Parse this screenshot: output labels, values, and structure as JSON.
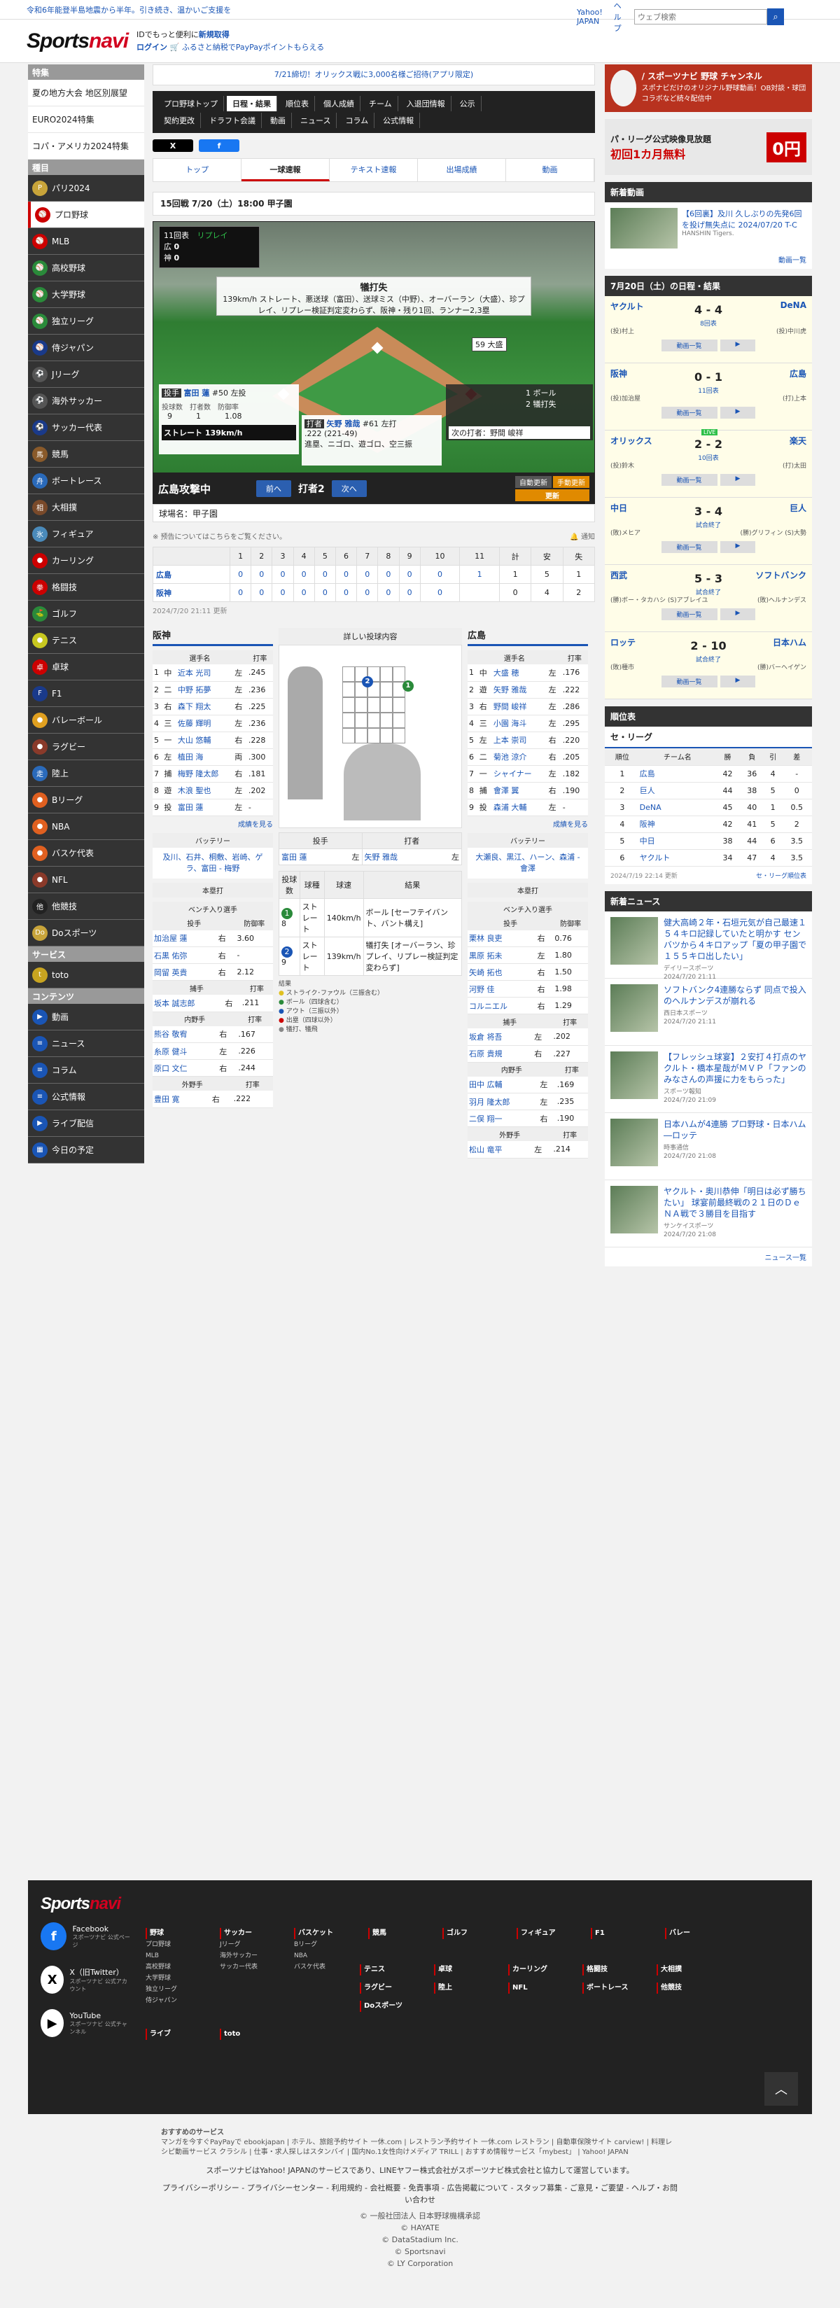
{
  "topbar": {
    "notice": "令和6年能登半島地震から半年。引き続き、温かいご支援を",
    "yahoo": "Yahoo! JAPAN",
    "help": "ヘルプ",
    "search_placeholder": "ウェブ検索"
  },
  "header": {
    "logo_a": "Sports",
    "logo_b": "navi",
    "promo1": "IDでもっと便利に",
    "promo1b": "新規取得",
    "promo2a": "ログイン",
    "promo2b": "ふるさと納税でPayPayポイントもらえる"
  },
  "sidebar": {
    "special_head": "特集",
    "special": [
      "夏の地方大会 地区別展望",
      "EURO2024特集",
      "コパ・アメリカ2024特集"
    ],
    "sports_head": "種目",
    "sports": [
      {
        "label": "パリ2024",
        "color": "#c8a43a",
        "glyph": "P"
      },
      {
        "label": "プロ野球",
        "color": "#c00",
        "glyph": "⚾",
        "active": true
      },
      {
        "label": "MLB",
        "color": "#c00",
        "glyph": "⚾"
      },
      {
        "label": "高校野球",
        "color": "#2a8a3a",
        "glyph": "⚾"
      },
      {
        "label": "大学野球",
        "color": "#2a8a3a",
        "glyph": "⚾"
      },
      {
        "label": "独立リーグ",
        "color": "#2a8a3a",
        "glyph": "⚾"
      },
      {
        "label": "侍ジャパン",
        "color": "#1a3a8a",
        "glyph": "⚾"
      },
      {
        "label": "Jリーグ",
        "color": "#555",
        "glyph": "⚽"
      },
      {
        "label": "海外サッカー",
        "color": "#555",
        "glyph": "⚽"
      },
      {
        "label": "サッカー代表",
        "color": "#1a3a8a",
        "glyph": "⚽"
      },
      {
        "label": "競馬",
        "color": "#8a5a2a",
        "glyph": "馬"
      },
      {
        "label": "ボートレース",
        "color": "#2a6aba",
        "glyph": "舟"
      },
      {
        "label": "大相撲",
        "color": "#7a4a2a",
        "glyph": "相"
      },
      {
        "label": "フィギュア",
        "color": "#4a8aba",
        "glyph": "氷"
      },
      {
        "label": "カーリング",
        "color": "#c00",
        "glyph": "●"
      },
      {
        "label": "格闘技",
        "color": "#c00",
        "glyph": "拳"
      },
      {
        "label": "ゴルフ",
        "color": "#2a8a3a",
        "glyph": "⛳"
      },
      {
        "label": "テニス",
        "color": "#c8c820",
        "glyph": "●"
      },
      {
        "label": "卓球",
        "color": "#c00",
        "glyph": "卓"
      },
      {
        "label": "F1",
        "color": "#1a3a8a",
        "glyph": "F"
      },
      {
        "label": "バレーボール",
        "color": "#e0a020",
        "glyph": "●"
      },
      {
        "label": "ラグビー",
        "color": "#8a3a2a",
        "glyph": "●"
      },
      {
        "label": "陸上",
        "color": "#2a6aba",
        "glyph": "走"
      },
      {
        "label": "Bリーグ",
        "color": "#e06020",
        "glyph": "●"
      },
      {
        "label": "NBA",
        "color": "#e06020",
        "glyph": "●"
      },
      {
        "label": "バスケ代表",
        "color": "#e06020",
        "glyph": "●"
      },
      {
        "label": "NFL",
        "color": "#8a3a2a",
        "glyph": "●"
      },
      {
        "label": "他競技",
        "color": "#222",
        "glyph": "他"
      },
      {
        "label": "Doスポーツ",
        "color": "#c8a43a",
        "glyph": "Do"
      }
    ],
    "service_head": "サービス",
    "service": [
      {
        "label": "toto",
        "color": "#c8a420",
        "glyph": "t"
      }
    ],
    "content_head": "コンテンツ",
    "content": [
      {
        "label": "動画",
        "glyph": "▶"
      },
      {
        "label": "ニュース",
        "glyph": "≡"
      },
      {
        "label": "コラム",
        "glyph": "≡"
      },
      {
        "label": "公式情報",
        "glyph": "≡"
      },
      {
        "label": "ライブ配信",
        "glyph": "▶"
      },
      {
        "label": "今日の予定",
        "glyph": "▦"
      }
    ]
  },
  "main": {
    "banner": "7/21締切！オリックス戦に3,000名様ご招待(アプリ限定)",
    "nav_row1": [
      "プロ野球トップ",
      "日程・結果",
      "順位表",
      "個人成績",
      "チーム",
      "入退団情報",
      "公示"
    ],
    "nav_row2": [
      "契約更改",
      "ドラフト会議",
      "動画",
      "ニュース",
      "コラム",
      "公式情報"
    ],
    "share_x": "X",
    "share_fb": "f",
    "tabs": [
      "トップ",
      "一球速報",
      "テキスト速報",
      "出場成績",
      "動画"
    ],
    "game_head": "15回戦 7/20（土）18:00 甲子園",
    "scoreboard": {
      "inning": "11回表",
      "status": "リプレイ",
      "hiro": "広",
      "hiro_s": "0",
      "han": "神",
      "han_s": "0"
    },
    "play": {
      "title": "犠打失",
      "desc": "139km/h ストレート、悪送球（富田）、送球ミス（中野）、オーバーラン（大盛）、珍プレイ、リプレー検証判定変わらず、阪神・残り1回、ランナー2,3塁"
    },
    "runner_label": "59 大盛",
    "pitcher": {
      "role": "投手",
      "name": "富田 蓮",
      "num": "#50",
      "hand": "左投",
      "h1": "投球数",
      "h2": "打者数",
      "h3": "防御率",
      "v1": "9",
      "v2": "1",
      "v3": "1.08",
      "pitch": "ストレート 139km/h"
    },
    "batter": {
      "role": "打者",
      "name": "矢野 雅哉",
      "num": "#61",
      "hand": "左打",
      "avg": ".222 (221-49)",
      "note": "進塁、ニゴロ、遊ゴロ、空三振"
    },
    "count": {
      "ball": "1 ボール",
      "strike": "2 犠打失",
      "next": "次の打者：野間 峻祥"
    },
    "pbar": {
      "attack": "広島攻撃中",
      "prev": "前へ",
      "batter_no": "打者2",
      "next": "次へ",
      "auto": "自動更新",
      "manual": "手動更新",
      "refresh": "更新"
    },
    "venue": "球場名：甲子園",
    "note": "※ 预告についてはこちらをご覧ください。",
    "notify": "通知",
    "linescore": {
      "headers": [
        "",
        "1",
        "2",
        "3",
        "4",
        "5",
        "6",
        "7",
        "8",
        "9",
        "10",
        "11",
        "計",
        "安",
        "失"
      ],
      "rows": [
        {
          "team": "広島",
          "cells": [
            "0",
            "0",
            "0",
            "0",
            "0",
            "0",
            "0",
            "0",
            "0",
            "0",
            "1",
            "1",
            "5",
            "1"
          ]
        },
        {
          "team": "阪神",
          "cells": [
            "0",
            "0",
            "0",
            "0",
            "0",
            "0",
            "0",
            "0",
            "0",
            "0",
            "",
            "0",
            "4",
            "2"
          ]
        }
      ]
    },
    "updated": "2024/7/20 21:11 更新",
    "hanshin": {
      "title": "阪神",
      "col_name": "選手名",
      "col_avg": "打率",
      "lineup": [
        [
          "1",
          "中",
          "近本 光司",
          "左",
          ".245"
        ],
        [
          "2",
          "二",
          "中野 拓夢",
          "左",
          ".236"
        ],
        [
          "3",
          "右",
          "森下 翔太",
          "右",
          ".225"
        ],
        [
          "4",
          "三",
          "佐藤 輝明",
          "左",
          ".236"
        ],
        [
          "5",
          "一",
          "大山 悠輔",
          "右",
          ".228"
        ],
        [
          "6",
          "左",
          "植田 海",
          "両",
          ".300"
        ],
        [
          "7",
          "捕",
          "梅野 隆太郎",
          "右",
          ".181"
        ],
        [
          "8",
          "遊",
          "木浪 聖也",
          "左",
          ".202"
        ],
        [
          "9",
          "投",
          "富田 蓮",
          "左",
          "-"
        ]
      ],
      "more": "成績を見る",
      "battery_head": "バッテリー",
      "battery": "及川、石井、桐敷、岩崎、ゲラ、富田 - 梅野",
      "hr_head": "本塁打",
      "bench_head": "ベンチ入り選手",
      "bp_head": "投手",
      "bp_col": "防御率",
      "bp": [
        [
          "加治屋 蓮",
          "右",
          "3.60"
        ],
        [
          "石黒 佑弥",
          "右",
          "-"
        ],
        [
          "岡留 英貴",
          "右",
          "2.12"
        ]
      ],
      "bc_head": "捕手",
      "bc": [
        [
          "坂本 誠志郎",
          "右",
          ".211"
        ]
      ],
      "bi_head": "内野手",
      "bi": [
        [
          "熊谷 敬宥",
          "右",
          ".167"
        ],
        [
          "糸原 健斗",
          "左",
          ".226"
        ],
        [
          "原口 文仁",
          "右",
          ".244"
        ]
      ],
      "bo_head": "外野手",
      "bo": [
        [
          "豊田 寛",
          "右",
          ".222"
        ]
      ]
    },
    "carp": {
      "title": "広島",
      "col_name": "選手名",
      "col_avg": "打率",
      "lineup": [
        [
          "1",
          "中",
          "大盛 穂",
          "左",
          ".176"
        ],
        [
          "2",
          "遊",
          "矢野 雅哉",
          "左",
          ".222"
        ],
        [
          "3",
          "右",
          "野間 峻祥",
          "左",
          ".286"
        ],
        [
          "4",
          "三",
          "小園 海斗",
          "左",
          ".295"
        ],
        [
          "5",
          "左",
          "上本 崇司",
          "右",
          ".220"
        ],
        [
          "6",
          "二",
          "菊池 涼介",
          "右",
          ".205"
        ],
        [
          "7",
          "一",
          "シャイナー",
          "左",
          ".182"
        ],
        [
          "8",
          "捕",
          "會澤 翼",
          "右",
          ".190"
        ],
        [
          "9",
          "投",
          "森浦 大輔",
          "左",
          "-"
        ]
      ],
      "more": "成績を見る",
      "battery_head": "バッテリー",
      "battery": "大瀬良、黒江、ハーン、森浦 - 會澤",
      "hr_head": "本塁打",
      "bench_head": "ベンチ入り選手",
      "bp_head": "投手",
      "bp_col": "防御率",
      "bp": [
        [
          "栗林 良吏",
          "右",
          "0.76"
        ],
        [
          "黒原 拓未",
          "左",
          "1.80"
        ],
        [
          "矢崎 拓也",
          "右",
          "1.50"
        ],
        [
          "河野 佳",
          "右",
          "1.98"
        ],
        [
          "コルニエル",
          "右",
          "1.29"
        ]
      ],
      "bc_head": "捕手",
      "bc": [
        [
          "坂倉 将吾",
          "左",
          ".202"
        ],
        [
          "石原 貴規",
          "右",
          ".227"
        ]
      ],
      "bi_head": "内野手",
      "bi": [
        [
          "田中 広輔",
          "左",
          ".169"
        ],
        [
          "羽月 隆太郎",
          "左",
          ".235"
        ],
        [
          "二俣 翔一",
          "右",
          ".190"
        ]
      ],
      "bo_head": "外野手",
      "bo": [
        [
          "松山 竜平",
          "左",
          ".214"
        ]
      ]
    },
    "zone": {
      "title": "詳しい投球内容",
      "p_head": "投手",
      "b_head": "打者",
      "pitcher": "富田 蓮",
      "pitcher_hand": "左",
      "batter": "矢野 雅哉",
      "batter_hand": "左",
      "cols": [
        "投球数",
        "球種",
        "球速",
        "結果"
      ],
      "rows": [
        {
          "no": "1",
          "n": "8",
          "type": "ストレート",
          "speed": "140km/h",
          "result": "ボール [セーフテイバント、バント構え]",
          "color": "#2a8a3a"
        },
        {
          "no": "2",
          "n": "9",
          "type": "ストレート",
          "speed": "139km/h",
          "result": "犠打失 [オーバーラン、珍プレイ、リプレー検証判定変わらず]",
          "color": "#1a55b5"
        }
      ],
      "legend_head": "結果",
      "legend": [
        "ストライク･ファウル（三振含む）",
        "ボール（四球含む）",
        "アウト（三振以外）",
        "出塁（四球以外）",
        "犠打、犠飛"
      ],
      "legend_colors": [
        "#e0c020",
        "#2a8a3a",
        "#1a55b5",
        "#c00",
        "#888"
      ]
    }
  },
  "right": {
    "ch_title": "/ スポーツナビ 野球 チャンネル",
    "ch_sub": "スポナビだけのオリジナル野球動画！OB対談・球団コラボなど続々配信中",
    "pl_title": "パ・リーグ公式映像見放題",
    "pl_sub": "初回1カ月無料",
    "pl_price": "0円",
    "video_head": "新着動画",
    "video": {
      "title": "【6回裏】及川 久しぶりの先発6回を投げ無失点に 2024/07/20 T-C",
      "meta": "HANSHIN Tigers.",
      "more": "動画一覧"
    },
    "sched_head": "7月20日（土）の日程・結果",
    "games": [
      {
        "home": "ヤクルト",
        "away": "DeNA",
        "score": "4 - 4",
        "status": "8回表",
        "hp": "(投)村上",
        "ap": "(投)中川虎",
        "btn1": "動画一覧"
      },
      {
        "home": "阪神",
        "away": "広島",
        "score": "0 - 1",
        "status": "11回表",
        "hp": "(投)加治屋",
        "ap": "(打)上本",
        "btn1": "動画一覧"
      },
      {
        "home": "オリックス",
        "away": "楽天",
        "score": "2 - 2",
        "status": "10回表",
        "hp": "(投)鈴木",
        "ap": "(打)太田",
        "btn1": "動画一覧",
        "live": "LIVE"
      },
      {
        "home": "中日",
        "away": "巨人",
        "score": "3 - 4",
        "status": "試合終了",
        "hp": "(敗)メヒア",
        "ap": "(勝)グリフィン (S)大勢",
        "btn1": "動画一覧"
      },
      {
        "home": "西武",
        "away": "ソフトバンク",
        "score": "5 - 3",
        "status": "試合終了",
        "hp": "(勝)ボー・タカハシ (S)アブレイユ",
        "ap": "(敗)ヘルナンデス",
        "btn1": "動画一覧"
      },
      {
        "home": "ロッテ",
        "away": "日本ハム",
        "score": "2 - 10",
        "status": "試合終了",
        "hp": "(敗)種市",
        "ap": "(勝)バーヘイゲン",
        "btn1": "動画一覧"
      }
    ],
    "stand_head": "順位表",
    "stand_league": "セ・リーグ",
    "stand_cols": [
      "順位",
      "チーム名",
      "勝",
      "負",
      "引",
      "差"
    ],
    "stand": [
      [
        "1",
        "広島",
        "42",
        "36",
        "4",
        "-"
      ],
      [
        "2",
        "巨人",
        "44",
        "38",
        "5",
        "0"
      ],
      [
        "3",
        "DeNA",
        "45",
        "40",
        "1",
        "0.5"
      ],
      [
        "4",
        "阪神",
        "42",
        "41",
        "5",
        "2"
      ],
      [
        "5",
        "中日",
        "38",
        "44",
        "6",
        "3.5"
      ],
      [
        "6",
        "ヤクルト",
        "34",
        "47",
        "4",
        "3.5"
      ]
    ],
    "stand_time": "2024/7/19 22:14 更新",
    "stand_more": "セ・リーグ順位表",
    "news_head": "新着ニュース",
    "news": [
      {
        "title": "健大高崎２年・石垣元気が自己最速１５４キロ記録していたと明かす センバツから４キロアップ「夏の甲子園で１５５キロ出したい」",
        "src": "デイリースポーツ",
        "time": "2024/7/20 21:11"
      },
      {
        "title": "ソフトバンク4連勝ならず 同点で投入のヘルナンデスが崩れる",
        "src": "西日本スポーツ",
        "time": "2024/7/20 21:11"
      },
      {
        "title": "【フレッシュ球宴】２安打４打点のヤクルト・橋本星哉がＭＶＰ「ファンのみなさんの声援に力をもらった」",
        "src": "スポーツ報知",
        "time": "2024/7/20 21:09"
      },
      {
        "title": "日本ハムが4連勝 プロ野球・日本ハム―ロッテ",
        "src": "時事通信",
        "time": "2024/7/20 21:08"
      },
      {
        "title": "ヤクルト・奥川恭伸「明日は必ず勝ちたい」 球宴前最終戦の２１日のＤｅＮＡ戦で３勝目を目指す",
        "src": "サンケイスポーツ",
        "time": "2024/7/20 21:08"
      }
    ],
    "news_more": "ニュース一覧"
  },
  "footer": {
    "social": [
      {
        "name": "Facebook",
        "sub": "スポーツナビ 公式ページ",
        "glyph": "f",
        "color": "#1877f2"
      },
      {
        "name": "X（旧Twitter）",
        "sub": "スポーツナビ 公式アカウント",
        "glyph": "X",
        "color": "#fff"
      },
      {
        "name": "YouTube",
        "sub": "スポーツナビ 公式チャンネル",
        "glyph": "▶",
        "color": "#fff"
      }
    ],
    "cols": [
      {
        "head": "野球",
        "items": [
          "プロ野球",
          "MLB",
          "高校野球",
          "大学野球",
          "独立リーグ",
          "侍ジャパン"
        ]
      },
      {
        "head": "サッカー",
        "items": [
          "Jリーグ",
          "海外サッカー",
          "サッカー代表"
        ]
      },
      {
        "head": "バスケット",
        "items": [
          "Bリーグ",
          "NBA",
          "バスケ代表"
        ]
      },
      {
        "head": "競馬",
        "items": []
      },
      {
        "head": "ゴルフ",
        "items": []
      },
      {
        "head": "フィギュア",
        "items": []
      },
      {
        "head": "F1",
        "items": []
      },
      {
        "head": "バレー",
        "items": []
      }
    ],
    "row2": [
      "テニス",
      "卓球",
      "カーリング",
      "格闘技",
      "大相撲"
    ],
    "row3": [
      "ラグビー",
      "陸上",
      "NFL",
      "ボートレース",
      "他競技"
    ],
    "row4": [
      "Doスポーツ"
    ],
    "row5": [
      "ライブ",
      "toto"
    ]
  },
  "bottom": {
    "links_head": "おすすめのサービス",
    "links": "マンガを今すぐPayPayで ebookjapan | ホテル、旅館予約サイト 一休.com | レストラン予約サイト 一休.com レストラン | 自動車保険サイト carview! | 料理レシピ動画サービス クラシル | 仕事・求人探しはスタンバイ | 国内No.1女性向けメディア TRILL | おすすめ情報サービス「mybest」 | Yahoo! JAPAN",
    "disclaimer": "スポーツナビはYahoo! JAPANのサービスであり、LINEヤフー株式会社がスポーツナビ株式会社と協力して運営しています。",
    "policy": "プライバシーポリシー - プライバシーセンター - 利用規約 - 会社概要 - 免責事項 - 広告掲載について - スタッフ募集 - ご意見・ご要望 - ヘルプ・お問い合わせ",
    "c1": "© 一般社団法人 日本野球機構承認",
    "c2": "© HAYATE",
    "c3": "© DataStadium Inc.",
    "c4": "© Sportsnavi",
    "c5": "© LY Corporation"
  }
}
